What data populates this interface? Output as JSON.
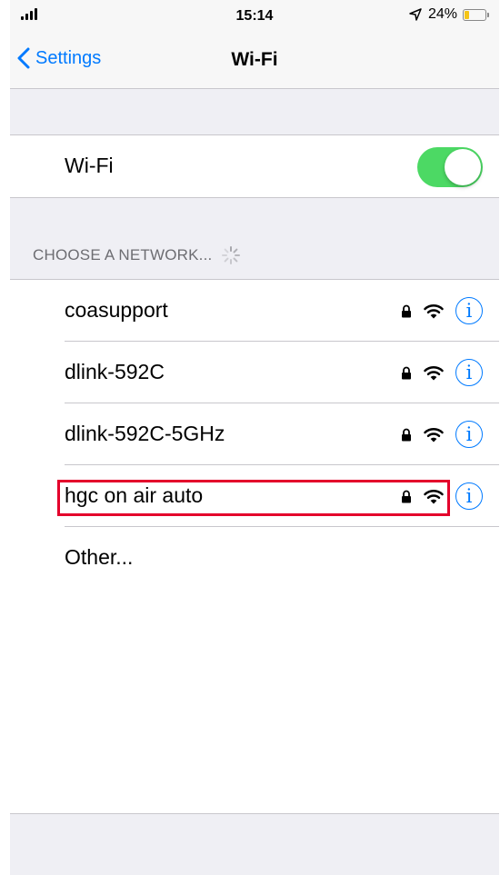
{
  "status_bar": {
    "time": "15:14",
    "battery_percent": "24%",
    "battery_level": 0.24,
    "battery_color": "#f5c518"
  },
  "nav": {
    "back_label": "Settings",
    "title": "Wi-Fi"
  },
  "wifi_toggle": {
    "label": "Wi-Fi",
    "on": true,
    "on_color": "#4cd964"
  },
  "networks_section": {
    "header": "CHOOSE A NETWORK...",
    "networks": [
      {
        "name": "coasupport",
        "secured": true
      },
      {
        "name": "dlink-592C",
        "secured": true
      },
      {
        "name": "dlink-592C-5GHz",
        "secured": true
      },
      {
        "name": "hgc on air auto",
        "secured": true,
        "highlighted": true
      }
    ],
    "other_label": "Other..."
  },
  "colors": {
    "accent": "#007aff",
    "highlight": "#e4002b",
    "group_background": "#efeff4"
  },
  "icons": {
    "back": "chevron-left-icon",
    "lock": "lock-icon",
    "wifi": "wifi-icon",
    "info": "info-icon",
    "spinner": "spinner-icon",
    "signal": "cellular-signal-icon",
    "location": "location-arrow-icon",
    "battery": "battery-icon"
  }
}
